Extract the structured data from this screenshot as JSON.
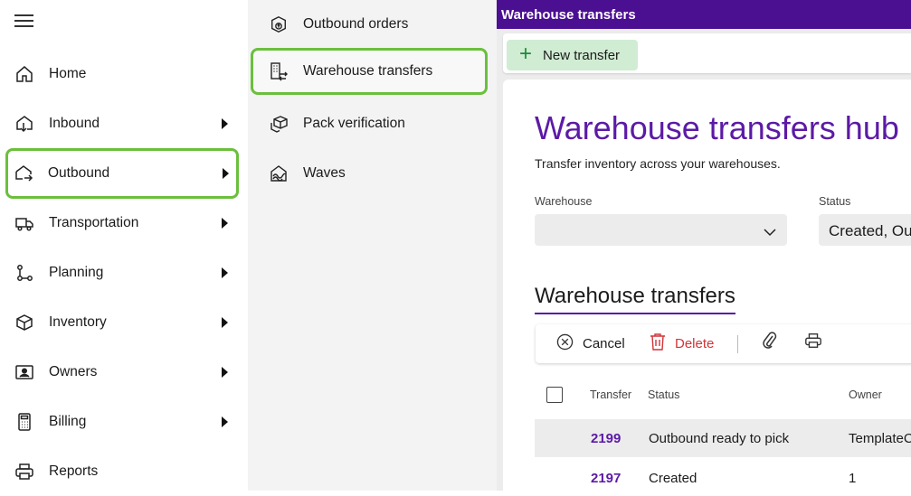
{
  "nav": {
    "items": [
      {
        "label": "Home",
        "icon": "home-icon",
        "has_submenu": false
      },
      {
        "label": "Inbound",
        "icon": "inbound-icon",
        "has_submenu": true
      },
      {
        "label": "Outbound",
        "icon": "outbound-icon",
        "has_submenu": true,
        "selected": true
      },
      {
        "label": "Transportation",
        "icon": "truck-icon",
        "has_submenu": true
      },
      {
        "label": "Planning",
        "icon": "planning-icon",
        "has_submenu": true
      },
      {
        "label": "Inventory",
        "icon": "box-icon",
        "has_submenu": true
      },
      {
        "label": "Owners",
        "icon": "contact-card-icon",
        "has_submenu": true
      },
      {
        "label": "Billing",
        "icon": "calculator-icon",
        "has_submenu": true
      },
      {
        "label": "Reports",
        "icon": "print-icon",
        "has_submenu": false
      }
    ]
  },
  "subnav": {
    "items": [
      {
        "label": "Outbound orders",
        "icon": "package-upload-icon"
      },
      {
        "label": "Warehouse transfers",
        "icon": "building-transfer-icon",
        "selected": true
      },
      {
        "label": "Pack verification",
        "icon": "packages-icon"
      },
      {
        "label": "Waves",
        "icon": "waves-icon"
      }
    ]
  },
  "topbar": {
    "title": "Warehouse transfers"
  },
  "commandbar": {
    "new_label": "New transfer"
  },
  "hub": {
    "title": "Warehouse transfers hub",
    "subtitle": "Transfer inventory across your warehouses."
  },
  "filters": {
    "warehouse_label": "Warehouse",
    "warehouse_value": "",
    "status_label": "Status",
    "status_value": "Created, Ou"
  },
  "section": {
    "title": "Warehouse transfers"
  },
  "toolbar": {
    "cancel_label": "Cancel",
    "delete_label": "Delete"
  },
  "table": {
    "columns": [
      "Transfer",
      "Status",
      "Owner"
    ],
    "rows": [
      {
        "transfer": "2199",
        "status": "Outbound ready to pick",
        "owner": "TemplateC"
      },
      {
        "transfer": "2197",
        "status": "Created",
        "owner": "1"
      }
    ]
  },
  "colors": {
    "accent": "#5c1aa6",
    "header": "#4b0f91",
    "highlight": "#6bbf3d",
    "new_button": "#d0ecd3",
    "delete": "#d13438"
  }
}
